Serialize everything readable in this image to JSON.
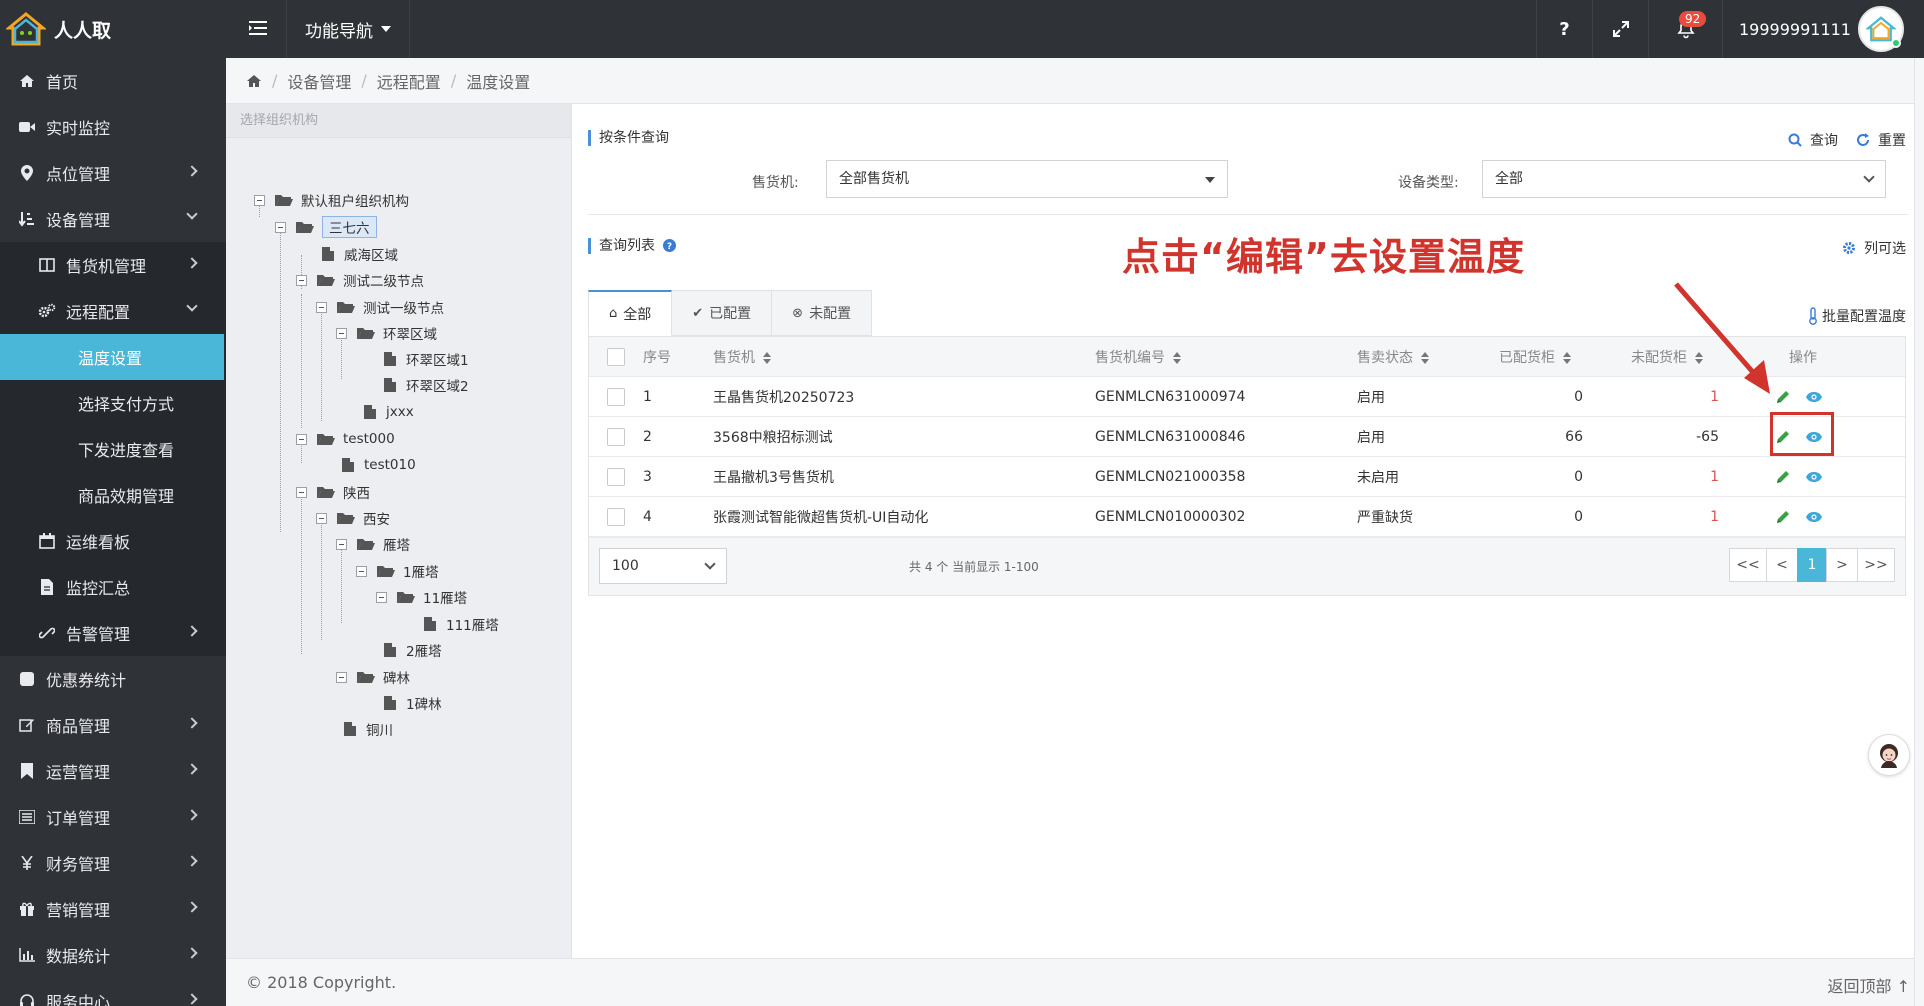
{
  "app": {
    "brand": "人人取",
    "nav_func": "功能导航",
    "help": "?",
    "bell_count": "92",
    "user": "19999991111"
  },
  "sidebar": {
    "items": [
      {
        "label": "首页",
        "icon": "home-icon"
      },
      {
        "label": "实时监控",
        "icon": "video-icon"
      },
      {
        "label": "点位管理",
        "icon": "map-marker-icon"
      },
      {
        "label": "设备管理",
        "icon": "sort-icon"
      },
      {
        "label": "售货机管理",
        "icon": "columns-icon"
      },
      {
        "label": "远程配置",
        "icon": "gears-icon"
      },
      {
        "label": "温度设置"
      },
      {
        "label": "选择支付方式"
      },
      {
        "label": "下发进度查看"
      },
      {
        "label": "商品效期管理"
      },
      {
        "label": "运维看板",
        "icon": "calendar-icon"
      },
      {
        "label": "监控汇总",
        "icon": "file-icon"
      },
      {
        "label": "告警管理",
        "icon": "chain-icon"
      },
      {
        "label": "优惠券统计",
        "icon": "square-icon"
      },
      {
        "label": "商品管理",
        "icon": "edit-icon"
      },
      {
        "label": "运营管理",
        "icon": "bookmark-icon"
      },
      {
        "label": "订单管理",
        "icon": "list-icon"
      },
      {
        "label": "财务管理",
        "icon": "yen-icon"
      },
      {
        "label": "营销管理",
        "icon": "gift-icon"
      },
      {
        "label": "数据统计",
        "icon": "bar-chart-icon"
      },
      {
        "label": "服务中心",
        "icon": "headset-icon"
      }
    ]
  },
  "breadcrumb": {
    "items": [
      "设备管理",
      "远程配置",
      "温度设置"
    ]
  },
  "tree": {
    "header": "选择组织机构",
    "nodes": [
      "默认租户组织机构",
      "三七六",
      "威海区域",
      "测试二级节点",
      "测试一级节点",
      "环翠区域",
      "环翠区域1",
      "环翠区域2",
      "jxxx",
      "test000",
      "test010",
      "陕西",
      "西安",
      "雁塔",
      "1雁塔",
      "11雁塔",
      "111雁塔",
      "2雁塔",
      "碑林",
      "1碑林",
      "铜川"
    ]
  },
  "query": {
    "title": "按条件查询",
    "search": "查询",
    "reset": "重置",
    "vending_label": "售货机:",
    "vending_value": "全部售货机",
    "devtype_label": "设备类型:",
    "devtype_value": "全部"
  },
  "list": {
    "title": "查询列表",
    "column_select": "列可选",
    "annotation": "点击“编辑”去设置温度",
    "batch": "批量配置温度",
    "tabs": [
      "全部",
      "已配置",
      "未配置"
    ],
    "headers": [
      "序号",
      "售货机",
      "售货机编号",
      "售卖状态",
      "已配货柜",
      "未配货柜",
      "操作"
    ],
    "rows": [
      {
        "no": "1",
        "name": "王晶售货机20250723",
        "code": "GENMLCN631000974",
        "status": "启用",
        "done": "0",
        "undone": "1"
      },
      {
        "no": "2",
        "name": "3568中粮招标测试",
        "code": "GENMLCN631000846",
        "status": "启用",
        "done": "66",
        "undone": "-65"
      },
      {
        "no": "3",
        "name": "王晶撤机3号售货机",
        "code": "GENMLCN021000358",
        "status": "未启用",
        "done": "0",
        "undone": "1"
      },
      {
        "no": "4",
        "name": "张霞测试智能微超售货机-UI自动化",
        "code": "GENMLCN010000302",
        "status": "严重缺货",
        "done": "0",
        "undone": "1"
      }
    ],
    "page_size": "100",
    "page_info": "共 4 个 当前显示 1-100",
    "pager": [
      "<<",
      "<",
      "1",
      ">",
      ">>"
    ]
  },
  "footer": {
    "copyright": "© 2018 Copyright.",
    "to_top": "返回顶部"
  },
  "colors": {
    "accent": "#4ab6d8",
    "annotation": "#d0342c",
    "edit_green": "#3aa142",
    "view_blue": "#3fa7d6"
  }
}
